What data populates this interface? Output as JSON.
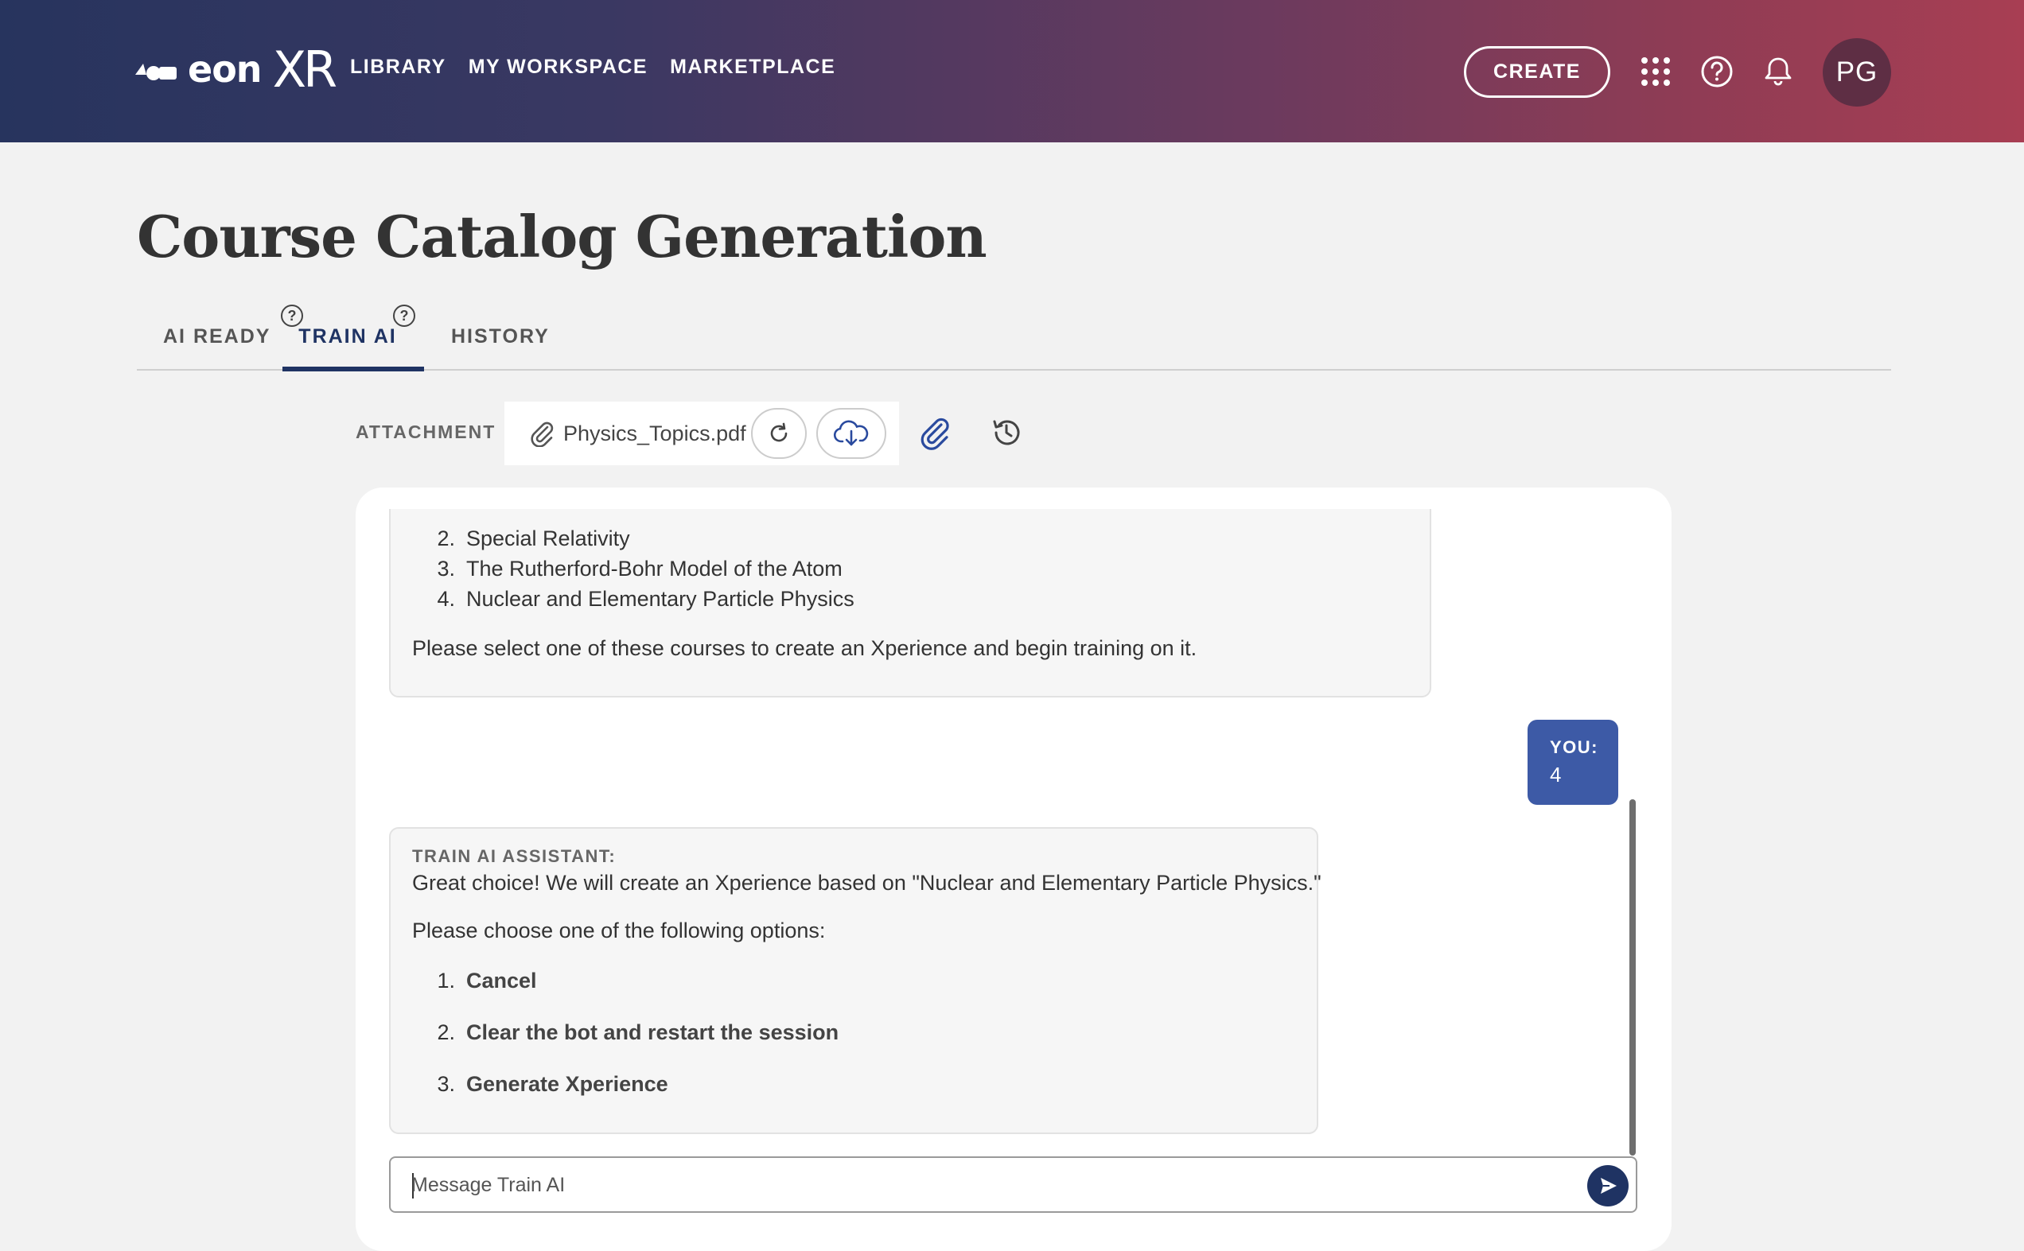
{
  "header": {
    "logo_text": "eon",
    "logo_xr": "XR",
    "nav": [
      "LIBRARY",
      "MY WORKSPACE",
      "MARKETPLACE"
    ],
    "create_label": "CREATE",
    "avatar_initials": "PG",
    "icons": [
      "apps-grid-icon",
      "help-icon",
      "bell-icon"
    ]
  },
  "page": {
    "title": "Course Catalog Generation",
    "tabs": [
      {
        "label": "AI READY",
        "help": "?"
      },
      {
        "label": "TRAIN AI",
        "help": "?",
        "active": true
      },
      {
        "label": "HISTORY"
      }
    ]
  },
  "attachment": {
    "label": "ATTACHMENT",
    "file_name": "Physics_Topics.pdf",
    "icons": [
      "paperclip-icon",
      "refresh-icon",
      "cloud-download-icon",
      "attach-file-icon",
      "history-icon"
    ]
  },
  "chat": {
    "messages": [
      {
        "role": "assistant",
        "items": [
          {
            "num": "2.",
            "text": "Special Relativity"
          },
          {
            "num": "3.",
            "text": "The Rutherford-Bohr Model of the Atom"
          },
          {
            "num": "4.",
            "text": "Nuclear and Elementary Particle Physics"
          }
        ],
        "footer": "Please select one of these courses to create an Xperience and begin training on it."
      },
      {
        "role": "user",
        "label": "YOU:",
        "text": "4"
      },
      {
        "role": "assistant",
        "label": "TRAIN AI ASSISTANT:",
        "text": "Great choice! We will create an Xperience based on \"Nuclear and Elementary Particle Physics.\"",
        "prompt": "Please choose one of the following options:",
        "options": [
          {
            "num": "1.",
            "text": "Cancel"
          },
          {
            "num": "2.",
            "text": "Clear the bot and restart the session"
          },
          {
            "num": "3.",
            "text": "Generate Xperience"
          }
        ]
      }
    ],
    "input_placeholder": "Message Train AI"
  },
  "colors": {
    "header_gradient_start": "#27345e",
    "header_gradient_end": "#a83e53",
    "accent_navy": "#1f3363",
    "user_bubble": "#3d5aa6",
    "avatar_bg": "#5e2e44"
  }
}
